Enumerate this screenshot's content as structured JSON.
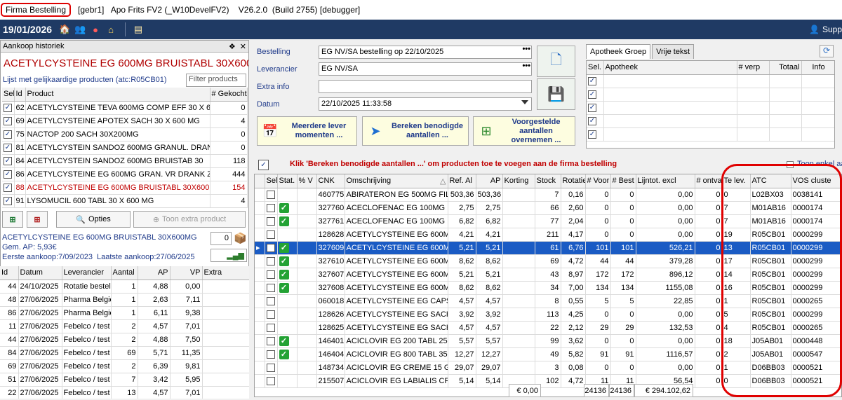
{
  "titlebar": {
    "label": "Firma Bestelling",
    "info": "[gebr1]   Apo Frits FV2 (_W10DevelFV2)    V26.2.0  (Build 2755) [debugger]"
  },
  "toolbar": {
    "date": "19/01/2026",
    "support": "Supp"
  },
  "history": {
    "header": "Aankoop historiek",
    "pin": "❖",
    "close": "✕",
    "product_title": "ACETYLCYSTEINE EG 600MG BRUISTABL 30X600MG",
    "similar_label": "Lijst met gelijkaardige producten (atc:R05CB01)",
    "filter_placeholder": "Filter products",
    "columns": {
      "sel": "Sel.",
      "id": "Id",
      "product": "Product",
      "bought": "# Gekocht"
    },
    "items": [
      {
        "id": "62",
        "name": "ACETYLCYSTEINE TEVA 600MG COMP EFF 30 X 60",
        "qty": "0"
      },
      {
        "id": "69",
        "name": "ACETYLCYSTEINE APOTEX SACH 30 X 600 MG",
        "qty": "4"
      },
      {
        "id": "75",
        "name": "NACTOP 200 SACH 30X200MG",
        "qty": "0"
      },
      {
        "id": "81",
        "name": "ACETYLCYSTEIN SANDOZ 600MG GRANUL. DRAN",
        "qty": "0"
      },
      {
        "id": "84",
        "name": "ACETYLCYSTEIN SANDOZ 600MG BRUISTAB 30",
        "qty": "118"
      },
      {
        "id": "86",
        "name": "ACETYLCYSTEINE EG 600MG GRAN. VR DRANK Z/",
        "qty": "444"
      },
      {
        "id": "88",
        "name": "ACETYLCYSTEINE EG 600MG BRUISTABL 30X600M",
        "qty": "154"
      },
      {
        "id": "91",
        "name": "LYSOMUCIL 600 TABL 30 X 600 MG",
        "qty": "4"
      }
    ],
    "opties": "Opties",
    "extra_product": "Toon extra product",
    "detail_name": "ACETYLCYSTEINE EG 600MG BRUISTABL 30X600MG",
    "detail_qty": "0",
    "gem_ap": "Gem. AP: 5,93€",
    "first_buy": "Eerste aankoop:7/09/2023",
    "last_buy": "Laatste aankoop:27/06/2025",
    "purchase_columns": {
      "id": "Id",
      "date": "Datum",
      "supplier": "Leverancier",
      "qty": "Aantal",
      "ap": "AP",
      "vp": "VP",
      "extra": "Extra"
    },
    "purchases": [
      {
        "id": "44",
        "date": "24/10/2025",
        "supplier": "Rotatie bestel",
        "qty": "1",
        "ap": "4,88",
        "vp": "0,00"
      },
      {
        "id": "48",
        "date": "27/06/2025",
        "supplier": "Pharma België",
        "qty": "1",
        "ap": "2,63",
        "vp": "7,11"
      },
      {
        "id": "86",
        "date": "27/06/2025",
        "supplier": "Pharma België",
        "qty": "1",
        "ap": "6,11",
        "vp": "9,38"
      },
      {
        "id": "11",
        "date": "27/06/2025",
        "supplier": "Febelco / test",
        "qty": "2",
        "ap": "4,57",
        "vp": "7,01"
      },
      {
        "id": "44",
        "date": "27/06/2025",
        "supplier": "Febelco / test",
        "qty": "2",
        "ap": "4,88",
        "vp": "7,50"
      },
      {
        "id": "84",
        "date": "27/06/2025",
        "supplier": "Febelco / test",
        "qty": "69",
        "ap": "5,71",
        "vp": "11,35"
      },
      {
        "id": "69",
        "date": "27/06/2025",
        "supplier": "Febelco / test",
        "qty": "2",
        "ap": "6,39",
        "vp": "9,81"
      },
      {
        "id": "51",
        "date": "27/06/2025",
        "supplier": "Febelco / test",
        "qty": "7",
        "ap": "3,42",
        "vp": "5,95"
      },
      {
        "id": "22",
        "date": "27/06/2025",
        "supplier": "Febelco / test",
        "qty": "13",
        "ap": "4,57",
        "vp": "7,01"
      }
    ]
  },
  "order": {
    "labels": {
      "bestelling": "Bestelling",
      "leverancier": "Leverancier",
      "extra": "Extra info",
      "datum": "Datum"
    },
    "bestelling": "EG NV/SA bestelling op 22/10/2025",
    "leverancier": "EG NV/SA",
    "extra": "",
    "datum": "22/10/2025 11:33:58",
    "ellipsis": "•••",
    "btn_multiple": "Meerdere lever momenten ...",
    "btn_calc": "Bereken benodigde aantallen ...",
    "btn_proposed": "Voorgestelde aantallen overnemen ...",
    "instruction": "Klik 'Bereken benodigde aantallen ...' om producten toe te voegen aan de firma bestelling",
    "toon_label": "Toon enkel aa"
  },
  "group": {
    "tabs": [
      "Apotheek Groep",
      "Vrije tekst"
    ],
    "columns": {
      "sel": "Sel.",
      "apotheek": "Apotheek",
      "verp": "# verp",
      "totaal": "Totaal",
      "info": "Info"
    }
  },
  "grid": {
    "columns": {
      "sel": "Sel",
      "stat": "Stat.",
      "pv": "% V",
      "cnk": "CNK",
      "desc": "Omschrijving",
      "ref": "Ref. Al",
      "ap": "AP",
      "korting": "Korting",
      "stock": "Stock",
      "rot": "Rotatie",
      "voor": "# Voor",
      "best": "# Best",
      "lijn": "Lijntot. excl",
      "ontv": "# ontva",
      "telev": "Te lev.",
      "atc": "ATC",
      "vos": "VOS cluste"
    },
    "rows": [
      {
        "stat": "",
        "cnk": "460775",
        "desc": "ABIRATERON EG 500MG FILMC",
        "ref": "503,36",
        "ap": "503,36",
        "stock": "7",
        "rot": "0,16",
        "voor": "0",
        "best": "0",
        "lijn": "0,00",
        "ontv": "0",
        "telev": "0",
        "atc": "L02BX03",
        "vos": "0038141",
        "sel": false
      },
      {
        "stat": "ok",
        "cnk": "327760",
        "desc": "ACECLOFENAC EG 100MG FILI",
        "ref": "2,75",
        "ap": "2,75",
        "stock": "66",
        "rot": "2,60",
        "voor": "0",
        "best": "0",
        "lijn": "0,00",
        "ontv": "0",
        "telev": "7",
        "atc": "M01AB16",
        "vos": "0000174",
        "sel": false
      },
      {
        "stat": "ok",
        "cnk": "327761",
        "desc": "ACECLOFENAC EG 100MG FILI",
        "ref": "6,82",
        "ap": "6,82",
        "stock": "77",
        "rot": "2,04",
        "voor": "0",
        "best": "0",
        "lijn": "0,00",
        "ontv": "0",
        "telev": "7",
        "atc": "M01AB16",
        "vos": "0000174",
        "sel": false
      },
      {
        "stat": "",
        "cnk": "128628",
        "desc": "ACETYLCYSTEINE EG 600MG I",
        "ref": "4,21",
        "ap": "4,21",
        "stock": "211",
        "rot": "4,17",
        "voor": "0",
        "best": "0",
        "lijn": "0,00",
        "ontv": "0",
        "telev": "19",
        "atc": "R05CB01",
        "vos": "0000299",
        "sel": false
      },
      {
        "stat": "ok",
        "cnk": "327609",
        "desc": "ACETYLCYSTEINE EG 600MG I",
        "ref": "5,21",
        "ap": "5,21",
        "stock": "61",
        "rot": "6,76",
        "voor": "101",
        "best": "101",
        "lijn": "526,21",
        "ontv": "0",
        "telev": "13",
        "atc": "R05CB01",
        "vos": "0000299",
        "sel": true
      },
      {
        "stat": "ok",
        "cnk": "327610",
        "desc": "ACETYLCYSTEINE EG 600MG I",
        "ref": "8,62",
        "ap": "8,62",
        "stock": "69",
        "rot": "4,72",
        "voor": "44",
        "best": "44",
        "lijn": "379,28",
        "ontv": "0",
        "telev": "17",
        "atc": "R05CB01",
        "vos": "0000299",
        "sel": false
      },
      {
        "stat": "ok",
        "cnk": "327607",
        "desc": "ACETYLCYSTEINE EG 600MG (",
        "ref": "5,21",
        "ap": "5,21",
        "stock": "43",
        "rot": "8,97",
        "voor": "172",
        "best": "172",
        "lijn": "896,12",
        "ontv": "0",
        "telev": "14",
        "atc": "R05CB01",
        "vos": "0000299",
        "sel": false
      },
      {
        "stat": "ok",
        "cnk": "327608",
        "desc": "ACETYLCYSTEINE EG 600MG (",
        "ref": "8,62",
        "ap": "8,62",
        "stock": "34",
        "rot": "7,00",
        "voor": "134",
        "best": "134",
        "lijn": "1155,08",
        "ontv": "0",
        "telev": "16",
        "atc": "R05CB01",
        "vos": "0000299",
        "sel": false
      },
      {
        "stat": "",
        "cnk": "060018",
        "desc": "ACETYLCYSTEINE EG CAPS 3",
        "ref": "4,57",
        "ap": "4,57",
        "stock": "8",
        "rot": "0,55",
        "voor": "5",
        "best": "5",
        "lijn": "22,85",
        "ontv": "0",
        "telev": "1",
        "atc": "R05CB01",
        "vos": "0000265",
        "sel": false
      },
      {
        "stat": "",
        "cnk": "128626",
        "desc": "ACETYLCYSTEINE EG SACH 1",
        "ref": "3,92",
        "ap": "3,92",
        "stock": "113",
        "rot": "4,25",
        "voor": "0",
        "best": "0",
        "lijn": "0,00",
        "ontv": "0",
        "telev": "5",
        "atc": "R05CB01",
        "vos": "0000299",
        "sel": false
      },
      {
        "stat": "",
        "cnk": "128625",
        "desc": "ACETYLCYSTEINE EG SACH 3",
        "ref": "4,57",
        "ap": "4,57",
        "stock": "22",
        "rot": "2,12",
        "voor": "29",
        "best": "29",
        "lijn": "132,53",
        "ontv": "0",
        "telev": "4",
        "atc": "R05CB01",
        "vos": "0000265",
        "sel": false
      },
      {
        "stat": "ok",
        "cnk": "146401",
        "desc": "ACICLOVIR EG 200     TABL 25",
        "ref": "5,57",
        "ap": "5,57",
        "stock": "99",
        "rot": "3,62",
        "voor": "0",
        "best": "0",
        "lijn": "0,00",
        "ontv": "0",
        "telev": "18",
        "atc": "J05AB01",
        "vos": "0000448",
        "sel": false
      },
      {
        "stat": "ok",
        "cnk": "146404",
        "desc": "ACICLOVIR EG 800     TABL 35",
        "ref": "12,27",
        "ap": "12,27",
        "stock": "49",
        "rot": "5,82",
        "voor": "91",
        "best": "91",
        "lijn": "1116,57",
        "ontv": "0",
        "telev": "2",
        "atc": "J05AB01",
        "vos": "0000547",
        "sel": false
      },
      {
        "stat": "",
        "cnk": "148734",
        "desc": "ACICLOVIR EG CREME 15 GR",
        "ref": "29,07",
        "ap": "29,07",
        "stock": "3",
        "rot": "0,08",
        "voor": "0",
        "best": "0",
        "lijn": "0,00",
        "ontv": "0",
        "telev": "1",
        "atc": "D06BB03",
        "vos": "0000521",
        "sel": false
      },
      {
        "stat": "",
        "cnk": "215507",
        "desc": "ACICLOVIR EG LABIALIS CREN",
        "ref": "5,14",
        "ap": "5,14",
        "stock": "102",
        "rot": "4,72",
        "voor": "11",
        "best": "11",
        "lijn": "56,54",
        "ontv": "0",
        "telev": "0",
        "atc": "D06BB03",
        "vos": "0000521",
        "sel": false
      }
    ],
    "totals": {
      "korting": "€ 0,00",
      "voor": "24136",
      "best": "24136",
      "lijn": "€ 294.102,62"
    }
  }
}
